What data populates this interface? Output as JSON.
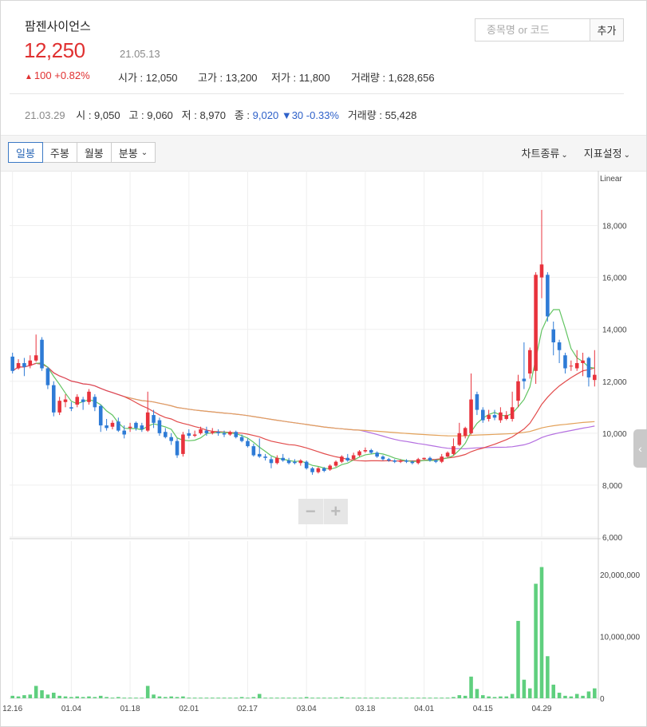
{
  "stock": {
    "name": "팜젠사이언스",
    "price": "12,250",
    "date": "21.05.13",
    "change_arrow": "▲",
    "change_value": "100",
    "change_pct": "+0.82%",
    "open_label": "시가",
    "open": "12,050",
    "high_label": "고가",
    "high": "13,200",
    "low_label": "저가",
    "low": "11,800",
    "volume_label": "거래량",
    "volume": "1,628,656"
  },
  "search": {
    "placeholder": "종목명 or 코드",
    "add_label": "추가"
  },
  "prev_day": {
    "date": "21.03.29",
    "open_label": "시",
    "open": "9,050",
    "high_label": "고",
    "high": "9,060",
    "low_label": "저",
    "low": "8,970",
    "close_label": "종",
    "close": "9,020",
    "change_arrow": "▼",
    "change_value": "30",
    "change_pct": "-0.33%",
    "volume_label": "거래량",
    "volume": "55,428"
  },
  "toolbar": {
    "tabs": [
      "일봉",
      "주봉",
      "월봉",
      "분봉"
    ],
    "chart_type_label": "차트종류",
    "indicator_label": "지표설정"
  },
  "colors": {
    "up": "#e8323c",
    "down": "#2e7bd6",
    "ma5": "#62c462",
    "ma20": "#e24b4b",
    "ma60": "#b46fe0",
    "ma120": "#e3a25a",
    "volume": "#5fcf7e"
  },
  "chart_data": {
    "type": "candlestick",
    "scale_label": "Linear",
    "price_ticks": [
      6000,
      8000,
      10000,
      12000,
      14000,
      16000,
      18000
    ],
    "price_range": [
      6000,
      19800
    ],
    "volume_ticks": [
      0,
      10000000,
      20000000
    ],
    "volume_range": [
      0,
      25400000
    ],
    "x_labels": [
      "12.16",
      "01.04",
      "01.18",
      "02.01",
      "02.17",
      "03.04",
      "03.18",
      "04.01",
      "04.15",
      "04.29"
    ],
    "x_label_index": [
      0,
      10,
      20,
      30,
      40,
      50,
      60,
      70,
      80,
      90
    ],
    "candles": [
      [
        12950,
        12400,
        13100,
        12300
      ],
      [
        12500,
        12700,
        12850,
        12450
      ],
      [
        12700,
        12550,
        12900,
        12200
      ],
      [
        12600,
        12800,
        13000,
        12500
      ],
      [
        12800,
        13000,
        13800,
        12750
      ],
      [
        13600,
        12500,
        13700,
        12400
      ],
      [
        12500,
        11850,
        12550,
        11700
      ],
      [
        11850,
        10800,
        12000,
        10650
      ],
      [
        10800,
        11250,
        11400,
        10700
      ],
      [
        11200,
        11300,
        11500,
        11000
      ],
      [
        11000,
        10950,
        11200,
        10850
      ],
      [
        11100,
        11400,
        11500,
        11000
      ],
      [
        11300,
        11200,
        11400,
        10900
      ],
      [
        11200,
        11600,
        11700,
        11100
      ],
      [
        11400,
        11000,
        11500,
        10850
      ],
      [
        11050,
        10300,
        11100,
        10050
      ],
      [
        10300,
        10200,
        10550,
        10100
      ],
      [
        10250,
        10400,
        10500,
        10150
      ],
      [
        10450,
        10100,
        10600,
        10050
      ],
      [
        10100,
        9950,
        10300,
        9800
      ],
      [
        10200,
        10250,
        10400,
        10050
      ],
      [
        10400,
        10200,
        10450,
        10100
      ],
      [
        10300,
        10150,
        10400,
        10050
      ],
      [
        10100,
        10800,
        11600,
        10050
      ],
      [
        10700,
        10400,
        10900,
        10200
      ],
      [
        10500,
        10000,
        10600,
        9900
      ],
      [
        10050,
        9850,
        10200,
        9800
      ],
      [
        9850,
        9700,
        10000,
        9550
      ],
      [
        9700,
        9150,
        9800,
        9050
      ],
      [
        9200,
        9950,
        10050,
        9100
      ],
      [
        10000,
        9900,
        10150,
        9800
      ],
      [
        9900,
        9950,
        10100,
        9850
      ],
      [
        10000,
        10150,
        10250,
        9950
      ],
      [
        10100,
        10000,
        10250,
        9900
      ],
      [
        10000,
        10050,
        10200,
        9950
      ],
      [
        10050,
        10000,
        10150,
        9900
      ],
      [
        10000,
        9950,
        10100,
        9850
      ],
      [
        9950,
        10050,
        10100,
        9900
      ],
      [
        10050,
        9850,
        10100,
        9800
      ],
      [
        9850,
        9700,
        9950,
        9650
      ],
      [
        9700,
        9500,
        9800,
        9450
      ],
      [
        9500,
        9150,
        9600,
        9100
      ],
      [
        9200,
        9100,
        9800,
        9050
      ],
      [
        9100,
        9050,
        9200,
        8950
      ],
      [
        9000,
        8850,
        9100,
        8650
      ],
      [
        8850,
        9050,
        9150,
        8800
      ],
      [
        9050,
        8950,
        9200,
        8900
      ],
      [
        8950,
        8850,
        9050,
        8800
      ],
      [
        8900,
        8850,
        9000,
        8800
      ],
      [
        8850,
        8950,
        9000,
        8750
      ],
      [
        8900,
        8650,
        8950,
        8600
      ],
      [
        8650,
        8500,
        8700,
        8400
      ],
      [
        8500,
        8650,
        8700,
        8450
      ],
      [
        8650,
        8550,
        8700,
        8500
      ],
      [
        8600,
        8750,
        8800,
        8550
      ],
      [
        8750,
        8900,
        8950,
        8700
      ],
      [
        8900,
        9100,
        9150,
        8850
      ],
      [
        9050,
        8950,
        9200,
        8900
      ],
      [
        9000,
        9150,
        9250,
        8950
      ],
      [
        9150,
        9300,
        9350,
        9100
      ],
      [
        9300,
        9350,
        9450,
        9250
      ],
      [
        9350,
        9250,
        9400,
        9200
      ],
      [
        9250,
        9100,
        9300,
        9050
      ],
      [
        9100,
        9000,
        9150,
        8950
      ],
      [
        9000,
        8950,
        9050,
        8900
      ],
      [
        8950,
        8900,
        9000,
        8850
      ],
      [
        8900,
        8950,
        9000,
        8850
      ],
      [
        8950,
        8900,
        9000,
        8850
      ],
      [
        8900,
        8850,
        8950,
        8800
      ],
      [
        8850,
        9000,
        9050,
        8800
      ],
      [
        9000,
        9050,
        9060,
        8970
      ],
      [
        9050,
        8950,
        9100,
        8900
      ],
      [
        8950,
        8900,
        9000,
        8850
      ],
      [
        8900,
        9100,
        9200,
        8850
      ],
      [
        9100,
        9250,
        9300,
        9050
      ],
      [
        9200,
        9500,
        9800,
        9150
      ],
      [
        9550,
        10000,
        10400,
        9500
      ],
      [
        9900,
        10200,
        10250,
        9800
      ],
      [
        10000,
        11300,
        12300,
        9950
      ],
      [
        11500,
        10900,
        11600,
        10700
      ],
      [
        10900,
        10500,
        11000,
        10400
      ],
      [
        10550,
        10700,
        10900,
        10450
      ],
      [
        10700,
        10600,
        10900,
        10500
      ],
      [
        10500,
        10800,
        11000,
        10400
      ],
      [
        10550,
        10700,
        10850,
        10500
      ],
      [
        10550,
        11000,
        11600,
        10450
      ],
      [
        11250,
        12000,
        12250,
        11000
      ],
      [
        12100,
        12000,
        13500,
        11700
      ],
      [
        12300,
        13200,
        13300,
        12100
      ],
      [
        12400,
        16100,
        16200,
        11900
      ],
      [
        16000,
        16500,
        18600,
        15200
      ],
      [
        16100,
        14500,
        16200,
        14300
      ],
      [
        14000,
        13500,
        14300,
        13000
      ],
      [
        13500,
        13200,
        13600,
        12700
      ],
      [
        13000,
        12500,
        13100,
        12300
      ],
      [
        12600,
        12600,
        12800,
        12400
      ],
      [
        12500,
        12700,
        13200,
        12400
      ],
      [
        12700,
        12800,
        13100,
        12200
      ],
      [
        12900,
        12150,
        12950,
        11800
      ],
      [
        12050,
        12250,
        13200,
        11800
      ]
    ],
    "volumes": [
      400000,
      300000,
      500000,
      600000,
      2000000,
      1300000,
      600000,
      900000,
      400000,
      300000,
      200000,
      300000,
      200000,
      300000,
      200000,
      400000,
      200000,
      100000,
      200000,
      100000,
      100000,
      100000,
      100000,
      2000000,
      600000,
      300000,
      200000,
      300000,
      200000,
      300000,
      100000,
      100000,
      100000,
      100000,
      100000,
      100000,
      100000,
      100000,
      100000,
      200000,
      100000,
      200000,
      700000,
      100000,
      100000,
      100000,
      100000,
      100000,
      100000,
      100000,
      200000,
      100000,
      100000,
      100000,
      100000,
      100000,
      200000,
      100000,
      100000,
      100000,
      100000,
      100000,
      100000,
      100000,
      100000,
      100000,
      100000,
      100000,
      100000,
      100000,
      100000,
      100000,
      100000,
      100000,
      100000,
      200000,
      500000,
      400000,
      3500000,
      1500000,
      500000,
      300000,
      200000,
      300000,
      300000,
      700000,
      12500000,
      3000000,
      1600000,
      18500000,
      21200000,
      6800000,
      2200000,
      900000,
      400000,
      300000,
      700000,
      400000,
      1100000,
      1600000
    ]
  }
}
